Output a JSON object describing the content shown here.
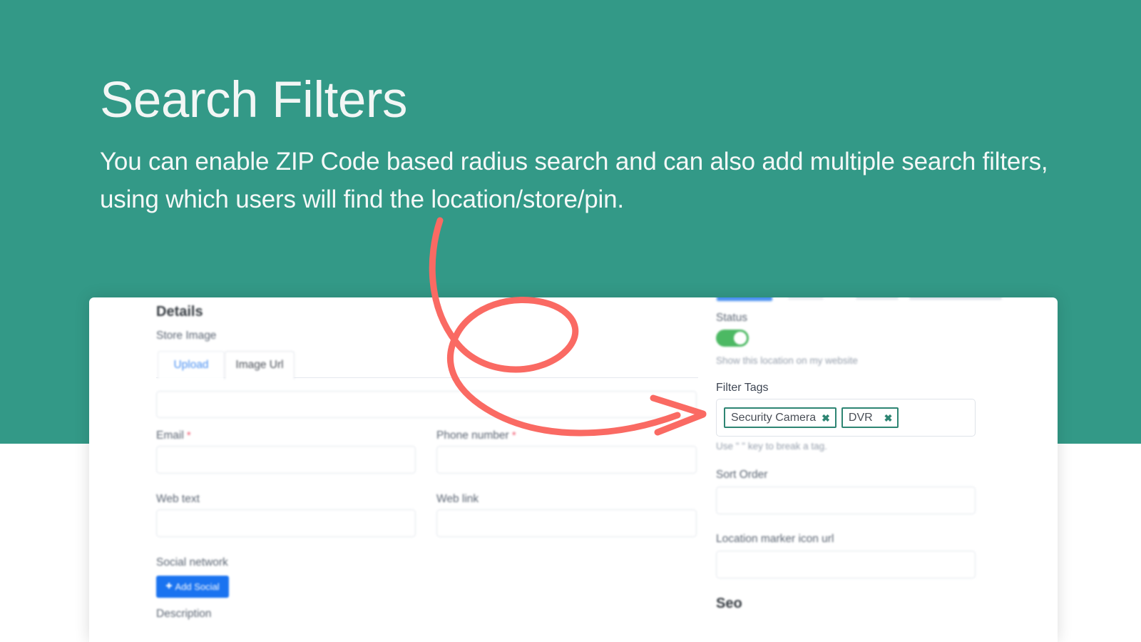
{
  "hero": {
    "title": "Search Filters",
    "subtitle": "You can enable ZIP Code based radius search and can also add multiple search filters, using which users will find the location/store/pin.",
    "bg_color": "#339987",
    "text_color": "#f2f6f5"
  },
  "annotation": {
    "color": "#fa6a63",
    "shape": "loop-arrow-pointing-right"
  },
  "app": {
    "left_panel": {
      "section_heading": "Details",
      "store_image_label": "Store Image",
      "tabs": [
        {
          "label": "Upload",
          "active": false
        },
        {
          "label": "Image Url",
          "active": true
        }
      ],
      "image_url_value": "",
      "fields": [
        {
          "label": "Email",
          "required": true,
          "value": ""
        },
        {
          "label": "Phone number",
          "required": true,
          "value": ""
        },
        {
          "label": "Web text",
          "required": false,
          "value": ""
        },
        {
          "label": "Web link",
          "required": false,
          "value": ""
        }
      ],
      "social_label": "Social network",
      "add_social_button": "Add Social",
      "add_social_icon": "plus-icon",
      "add_social_color": "#1a73f0",
      "description_label": "Description"
    },
    "right_panel": {
      "status_label": "Status",
      "status_enabled": true,
      "status_color": "#4cb963",
      "status_hint": "Show this location on my website",
      "filter_tags_label": "Filter Tags",
      "filter_tags": [
        {
          "label": "Security Camera",
          "remove_icon": "✖"
        },
        {
          "label": "DVR",
          "remove_icon": "✖"
        }
      ],
      "tag_border_color": "#2e8573",
      "tags_hint": "Use \" \" key to break a tag.",
      "sort_order_label": "Sort Order",
      "sort_order_value": "",
      "marker_url_label": "Location marker icon url",
      "marker_url_value": "",
      "seo_heading": "Seo"
    }
  }
}
